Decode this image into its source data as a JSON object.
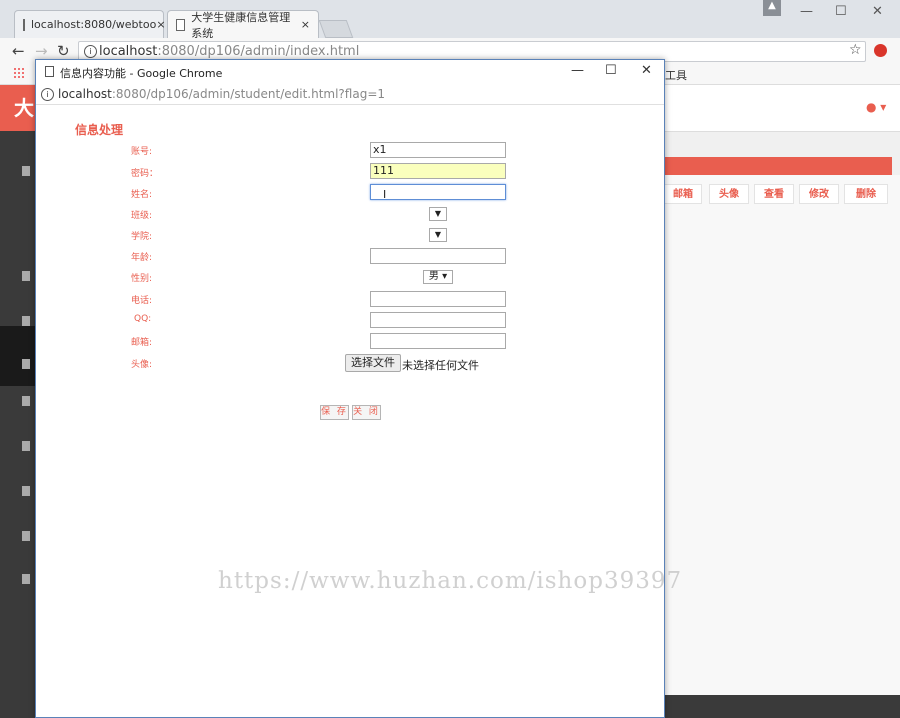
{
  "browser": {
    "tabs": [
      {
        "title": "localhost:8080/webtoo",
        "close": "×"
      },
      {
        "title": "大学生健康信息管理系统",
        "close": "×"
      }
    ],
    "url_host": "localhost",
    "url_rest": ":8080/dp106/admin/index.html",
    "bookmark_right": "工具"
  },
  "admin": {
    "logo": "大",
    "columns": [
      "邮箱",
      "头像",
      "查看",
      "修改",
      "删除"
    ]
  },
  "popup": {
    "window_title": "信息内容功能 - Google Chrome",
    "url_host": "localhost",
    "url_rest": ":8080/dp106/admin/student/edit.html?flag=1",
    "heading": "信息处理",
    "fields": {
      "account_label": "账号:",
      "account_value": "x1",
      "password_label": "密码：",
      "password_value": "111",
      "name_label": "姓名:",
      "name_value": "",
      "class_label": "班级:",
      "college_label": "学院:",
      "age_label": "年龄:",
      "gender_label": "性别:",
      "gender_value": "男",
      "phone_label": "电话:",
      "qq_label": "QQ:",
      "email_label": "邮箱:",
      "avatar_label": "头像:",
      "file_button": "选择文件",
      "file_status": "未选择任何文件"
    },
    "save_button": "保 存",
    "close_button": "关 闭"
  },
  "watermark": "https://www.huzhan.com/ishop39397",
  "colors": {
    "accent": "#e95e4f",
    "autofill": "#faffbd"
  }
}
